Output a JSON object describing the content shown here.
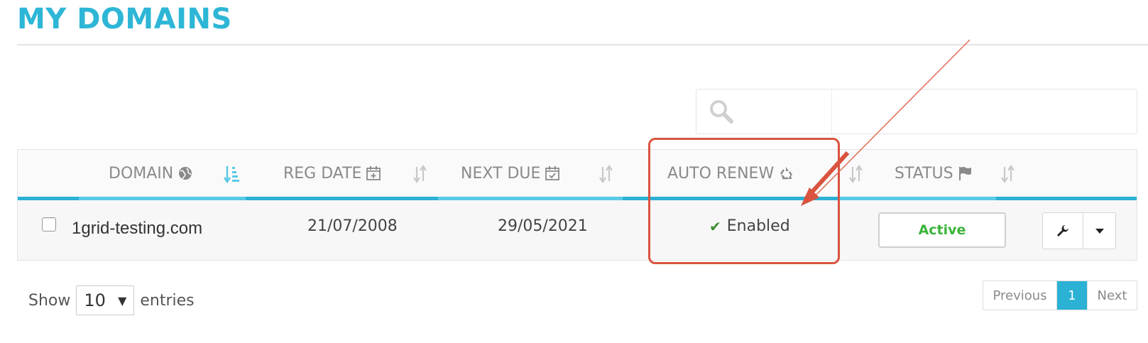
{
  "page": {
    "title": "MY DOMAINS"
  },
  "search": {
    "value": "",
    "placeholder": ""
  },
  "table": {
    "columns": [
      {
        "label": "DOMAIN",
        "icon": "globe-icon",
        "sort": "ascending"
      },
      {
        "label": "REG DATE",
        "icon": "calendar-plus-icon",
        "sort": "none"
      },
      {
        "label": "NEXT DUE",
        "icon": "calendar-check-icon",
        "sort": "none"
      },
      {
        "label": "AUTO RENEW",
        "icon": "recycle-icon",
        "sort": "none"
      },
      {
        "label": "STATUS",
        "icon": "flag-icon",
        "sort": "none"
      }
    ],
    "rows": [
      {
        "domain": "1grid-testing.com",
        "reg_date": "21/07/2008",
        "next_due": "29/05/2021",
        "auto_renew": "Enabled",
        "status": "Active"
      }
    ]
  },
  "length_menu": {
    "prefix": "Show",
    "value": "10",
    "suffix": "entries"
  },
  "pagination": {
    "previous": "Previous",
    "current": "1",
    "next": "Next"
  },
  "colors": {
    "accent": "#2ab1d4",
    "title": "#2db6d6",
    "status_active": "#3bb43b",
    "enabled_check": "#3a8f2e",
    "annotation": "#d9533f"
  }
}
